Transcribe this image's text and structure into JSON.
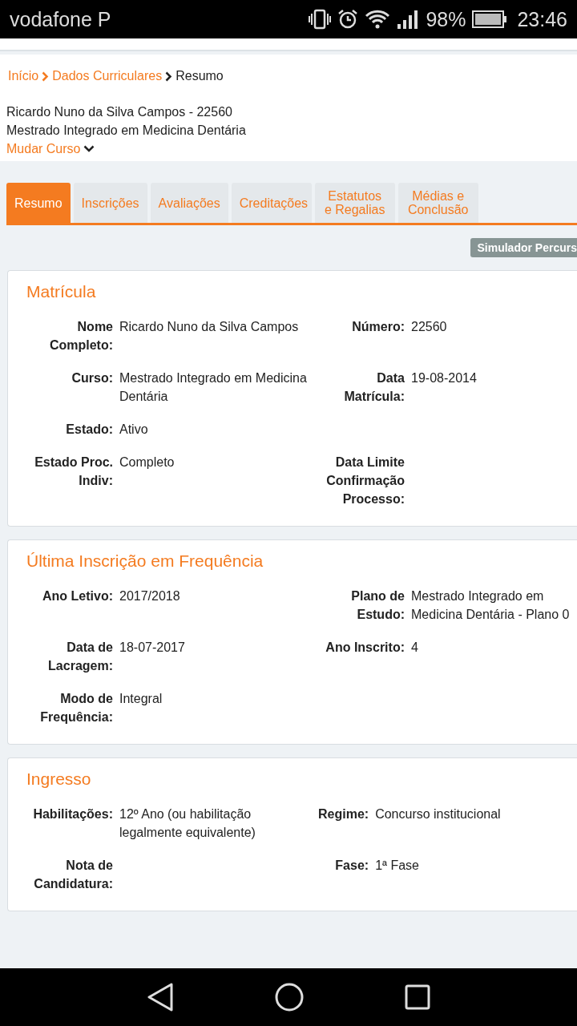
{
  "status_bar": {
    "carrier": "vodafone P",
    "battery": "98%",
    "time": "23:46"
  },
  "breadcrumb": [
    {
      "label": "Início",
      "kind": "link"
    },
    {
      "label": "Dados Curriculares",
      "kind": "link"
    },
    {
      "label": "Resumo",
      "kind": "current"
    }
  ],
  "student": {
    "name": "Ricardo Nuno da Silva Campos - 22560",
    "course": "Mestrado Integrado em Medicina Dentária",
    "change_course": "Mudar Curso"
  },
  "tabs": [
    {
      "label": "Resumo",
      "selected": true
    },
    {
      "label": "Inscrições",
      "selected": false
    },
    {
      "label": "Avaliações",
      "selected": false
    },
    {
      "label": "Creditações",
      "selected": false
    },
    {
      "label": "Estatutos e Regalias",
      "selected": false
    },
    {
      "label": "Médias e Conclusão",
      "selected": false
    }
  ],
  "simulator_button": "Simulador Percurs",
  "sections": [
    {
      "title": "Matrícula",
      "rows": [
        [
          {
            "label": "Nome Completo:",
            "value": "Ricardo Nuno da Silva Campos"
          },
          {
            "label": "Número:",
            "value": "22560"
          }
        ],
        [
          {
            "label": "Curso:",
            "value": "Mestrado Integrado em Medicina Dentária"
          },
          {
            "label": "Data Matrícula:",
            "value": "19-08-2014"
          }
        ],
        [
          {
            "label": "Estado:",
            "value": "Ativo"
          }
        ],
        [
          {
            "label": "Estado Proc. Indiv:",
            "value": "Completo"
          },
          {
            "label": "Data Limite Confirmação Processo:"
          }
        ]
      ]
    },
    {
      "title": "Última Inscrição em Frequência",
      "rows": [
        [
          {
            "label": "Ano Letivo:",
            "value": "2017/2018"
          },
          {
            "label": "Plano de Estudo:",
            "value": "Mestrado Integrado em Medicina Dentária - Plano 0"
          }
        ],
        [
          {
            "label": "Data de Lacragem:",
            "value": "18-07-2017"
          },
          {
            "label": "Ano Inscrito:",
            "value": "4"
          }
        ],
        [
          {
            "label": "Modo de Frequência:",
            "value": "Integral"
          }
        ]
      ]
    },
    {
      "title": "Ingresso",
      "rows": [
        [
          {
            "label": "Habilitações:",
            "value": "12º Ano (ou habilitação legalmente equivalente)"
          },
          {
            "label": "Regime:",
            "value": "Concurso institucional"
          }
        ],
        [
          {
            "label": "Nota de Candidatura:"
          },
          {
            "label": "Fase:",
            "value": "1ª Fase"
          }
        ]
      ]
    }
  ]
}
